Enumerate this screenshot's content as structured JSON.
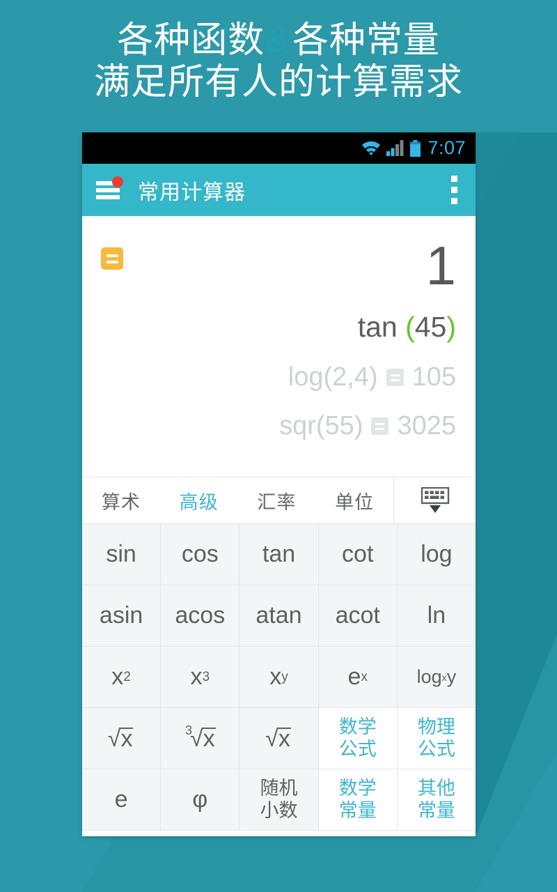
{
  "promo": {
    "line1_part1": "各种函数",
    "line1_amp": "&",
    "line1_part2": "各种常量",
    "line2": "满足所有人的计算需求"
  },
  "colors": {
    "background_teal": "#2b99a9",
    "appbar_teal": "#34b7c8",
    "accent_teal": "#3fb6cc",
    "status_time_blue": "#32b7e7",
    "badge_orange": "#f8b93d",
    "badge_red": "#ef3b33",
    "paren_green": "#66c528",
    "key_gray": "#f4f5f6"
  },
  "statusbar": {
    "time": "7:07",
    "icons": [
      "wifi-icon",
      "signal-icon",
      "battery-icon"
    ]
  },
  "appbar": {
    "menu_icon": "hamburger-menu-icon",
    "badge": "notification-dot",
    "title": "常用计算器",
    "overflow_icon": "overflow-menu-icon"
  },
  "display": {
    "equals_badge": "equals-badge-icon",
    "result": "1",
    "expression_fn": "tan ",
    "expression_open": "(",
    "expression_arg": "45",
    "expression_close": ")",
    "history": [
      {
        "expression": "log(2,4)",
        "equals_icon": "equals-icon",
        "result": "105"
      },
      {
        "expression": "sqr(55)",
        "equals_icon": "equals-icon",
        "result": "3025"
      }
    ]
  },
  "tabs": [
    {
      "label": "算术",
      "active": false
    },
    {
      "label": "高级",
      "active": true
    },
    {
      "label": "汇率",
      "active": false
    },
    {
      "label": "单位",
      "active": false
    }
  ],
  "keyboard_toggle_icon": "hide-keyboard-icon",
  "keypad": {
    "rows": [
      [
        {
          "label": "sin",
          "style": "gray"
        },
        {
          "label": "cos",
          "style": "gray"
        },
        {
          "label": "tan",
          "style": "gray"
        },
        {
          "label": "cot",
          "style": "gray"
        },
        {
          "label": "log",
          "style": "gray"
        }
      ],
      [
        {
          "label": "asin",
          "style": "gray"
        },
        {
          "label": "acos",
          "style": "gray"
        },
        {
          "label": "atan",
          "style": "gray"
        },
        {
          "label": "acot",
          "style": "gray"
        },
        {
          "label": "ln",
          "style": "gray"
        }
      ],
      [
        {
          "base": "x",
          "sup": "2",
          "style": "gray"
        },
        {
          "base": "x",
          "sup": "3",
          "style": "gray"
        },
        {
          "base": "x",
          "sup": "y",
          "style": "gray"
        },
        {
          "base": "e",
          "sup": "x",
          "style": "gray"
        },
        {
          "base": "log",
          "sub": "x",
          "tail": "y",
          "style": "gray"
        }
      ],
      [
        {
          "radical_index": "",
          "radical_body": "x",
          "style": "gray"
        },
        {
          "radical_index": "3",
          "radical_body": "x",
          "style": "gray"
        },
        {
          "radical_index": "",
          "radical_body": "x",
          "style": "gray"
        },
        {
          "line1": "数学",
          "line2": "公式",
          "style": "white"
        },
        {
          "line1": "物理",
          "line2": "公式",
          "style": "white"
        }
      ],
      [
        {
          "label": "e",
          "style": "gray"
        },
        {
          "label": "φ",
          "style": "gray"
        },
        {
          "line1": "随机",
          "line2": "小数",
          "style": "gray-small"
        },
        {
          "line1": "数学",
          "line2": "常量",
          "style": "white"
        },
        {
          "line1": "其他",
          "line2": "常量",
          "style": "white"
        }
      ]
    ]
  }
}
